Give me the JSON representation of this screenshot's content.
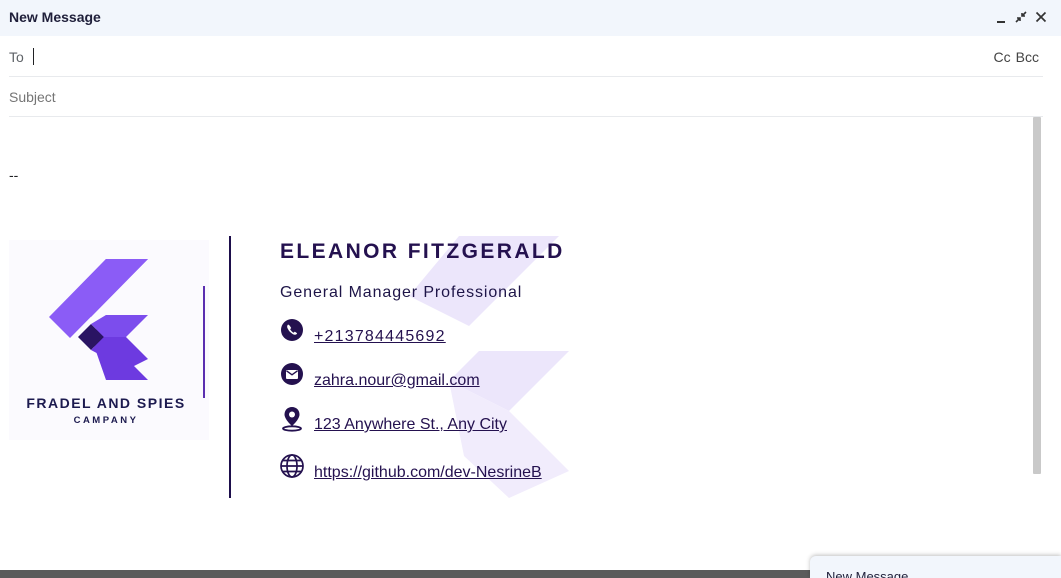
{
  "window": {
    "title": "New Message"
  },
  "header_icons": [
    "minimize-icon",
    "exit-fullscreen-icon",
    "close-icon"
  ],
  "to": {
    "label": "To",
    "value": ""
  },
  "cc_label": "Cc",
  "bcc_label": "Bcc",
  "subject": {
    "placeholder": "Subject",
    "value": ""
  },
  "body": {
    "separator": "--"
  },
  "signature": {
    "company": {
      "name": "FRADEL AND SPIES",
      "sub": "CAMPANY"
    },
    "name": "ELEANOR FITZGERALD",
    "role": "General Manager Professional",
    "phone": {
      "icon": "phone-icon",
      "text": "+213784445692"
    },
    "email": {
      "icon": "email-icon",
      "text": "zahra.nour@gmail.com"
    },
    "address": {
      "icon": "location-pin-icon",
      "text": "123 Anywhere St., Any City"
    },
    "website": {
      "icon": "globe-icon",
      "text": "https://github.com/dev-NesrineB"
    },
    "colors": {
      "primary": "#24114f",
      "accent_light": "#8b5cf6",
      "accent_mid": "#6d3ae0",
      "accent_dark": "#2a1463"
    }
  },
  "minimized_window": {
    "title": "New Message"
  }
}
